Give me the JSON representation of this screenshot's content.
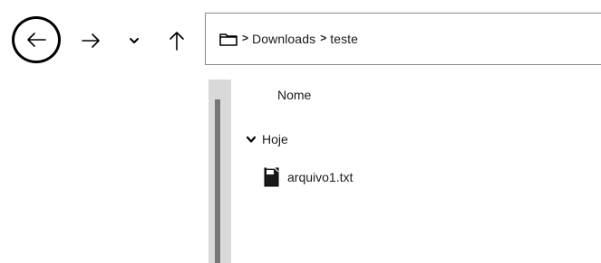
{
  "nav": {
    "back": "back",
    "forward": "forward",
    "recent": "recent-locations",
    "up": "up"
  },
  "address_bar": {
    "folder_icon": "folder-icon",
    "crumbs": [
      "Downloads",
      "teste"
    ]
  },
  "file_list": {
    "column_header": "Nome",
    "group_label": "Hoje",
    "files": [
      {
        "name": "arquivo1.txt",
        "icon": "file-icon"
      }
    ]
  },
  "colors": {
    "scroll_track": "#d9d9d9",
    "scroll_thumb": "#777777",
    "address_border": "#8c8c8c"
  }
}
